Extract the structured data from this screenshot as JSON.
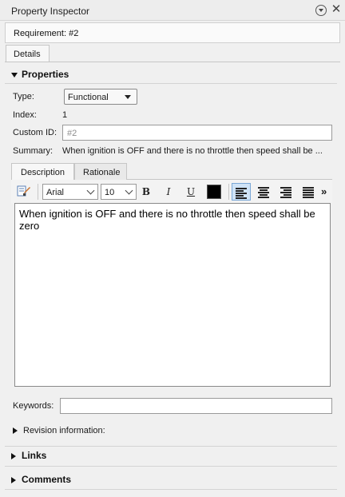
{
  "window": {
    "title": "Property Inspector",
    "menu_icon": "circle-chevron-down-icon",
    "close_glyph": "✕"
  },
  "header": {
    "requirement_label": "Requirement: #2"
  },
  "tabs": {
    "details": "Details"
  },
  "properties": {
    "heading": "Properties",
    "type_label": "Type:",
    "type_value": "Functional",
    "index_label": "Index:",
    "index_value": "1",
    "custom_id_label": "Custom ID:",
    "custom_id_placeholder": "#2",
    "summary_label": "Summary:",
    "summary_value": "When ignition is OFF and there is no throttle then speed shall be ..."
  },
  "description_tabs": {
    "description": "Description",
    "rationale": "Rationale"
  },
  "toolbar": {
    "font_family": "Arial",
    "font_size": "10",
    "bold": "B",
    "italic": "I",
    "underline": "U",
    "text_color": "#000000",
    "more": "»"
  },
  "editor": {
    "text": "When ignition is OFF and there is no throttle then speed shall be zero"
  },
  "keywords": {
    "label": "Keywords:",
    "value": ""
  },
  "revision": {
    "label": "Revision information:"
  },
  "sections": {
    "links": "Links",
    "comments": "Comments"
  },
  "colors": {
    "accent": "#7aa7d6",
    "active_align_bg": "#cfe3f7"
  }
}
